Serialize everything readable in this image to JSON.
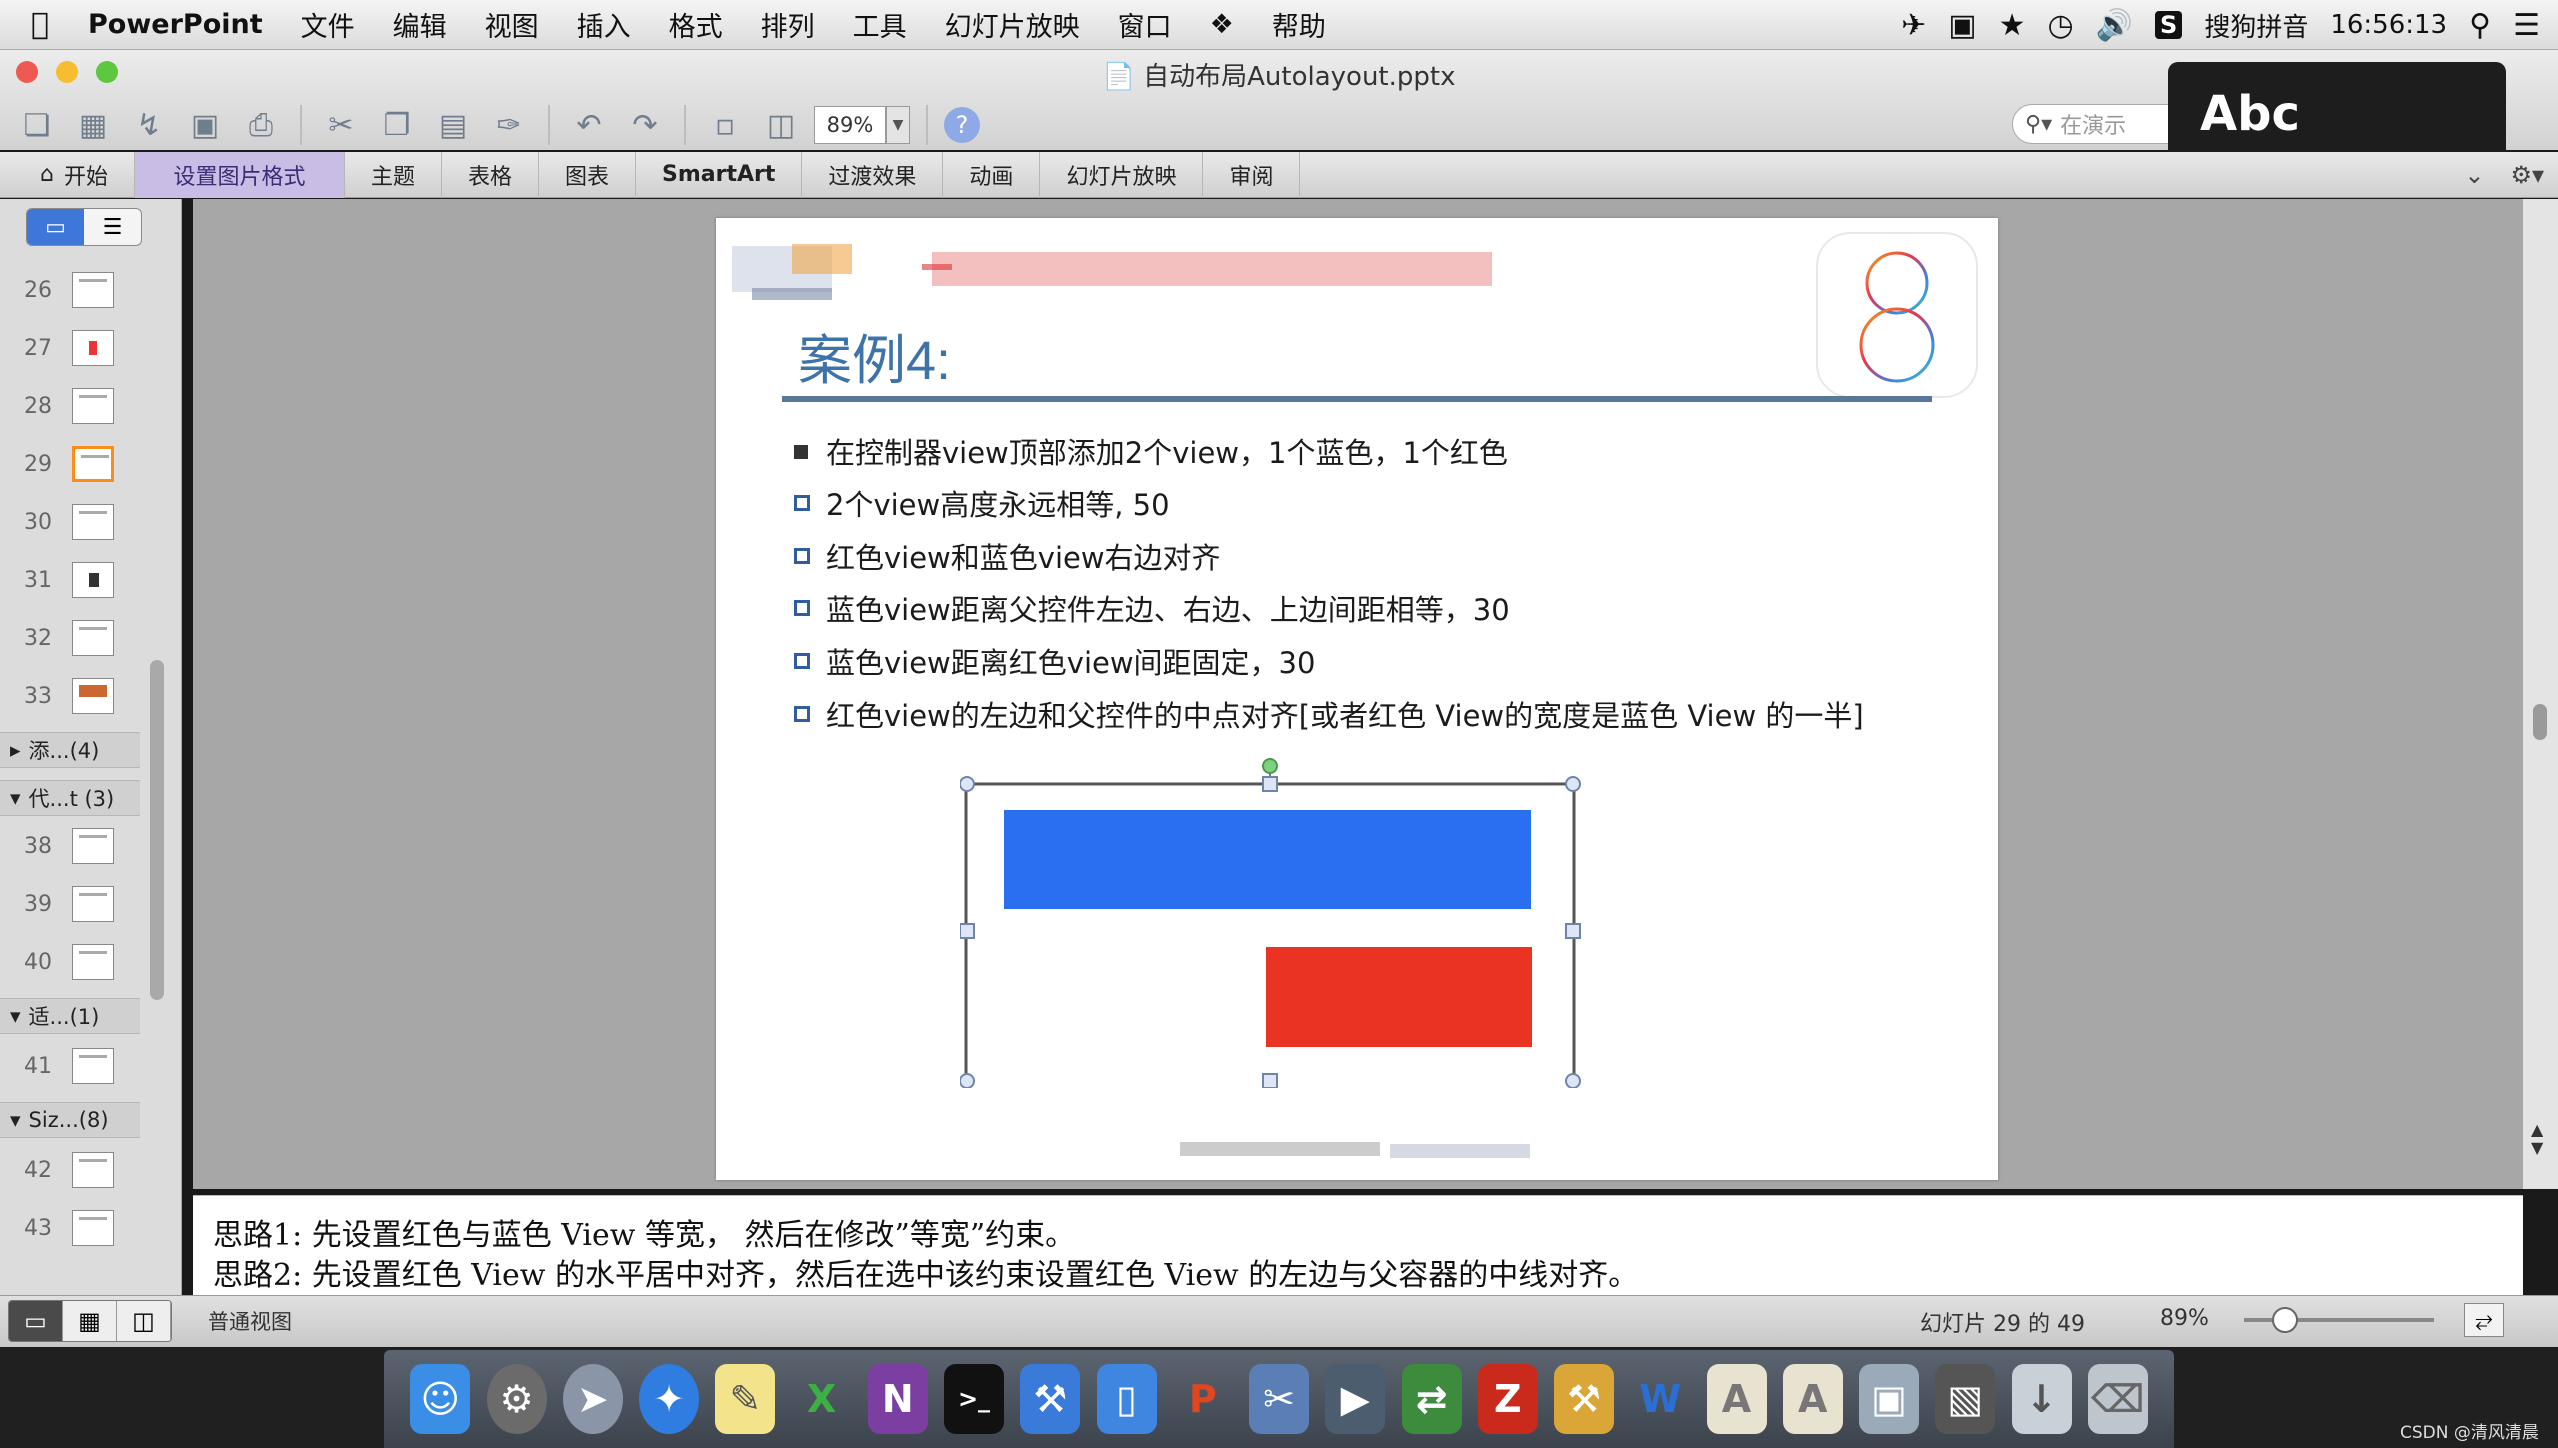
{
  "menubar": {
    "app_name": "PowerPoint",
    "menus": [
      "文件",
      "编辑",
      "视图",
      "插入",
      "格式",
      "排列",
      "工具",
      "幻灯片放映",
      "窗口",
      "帮助"
    ],
    "input_method": "搜狗拼音",
    "time": "16:56:13"
  },
  "window": {
    "title": "自动布局Autolayout.pptx"
  },
  "toolbar": {
    "zoom_value": "89%",
    "search_placeholder": "在演示"
  },
  "overlay": {
    "abc_label": "Abc"
  },
  "ribbon": {
    "tabs": [
      "开始",
      "设置图片格式",
      "主题",
      "表格",
      "图表",
      "SmartArt",
      "过渡效果",
      "动画",
      "幻灯片放映",
      "审阅"
    ],
    "active_tab": "设置图片格式"
  },
  "slide_panel": {
    "slides_a": [
      "26",
      "27",
      "28",
      "29",
      "30",
      "31",
      "32",
      "33"
    ],
    "selected_slide": "29",
    "sections": [
      "添...(4)",
      "代...t (3)",
      "适...(1)",
      "Siz...(8)"
    ],
    "slides_b": [
      "38",
      "39",
      "40"
    ],
    "slides_c": [
      "41"
    ],
    "slides_d": [
      "42",
      "43"
    ]
  },
  "slide": {
    "title": "案例4:",
    "os_badge": "8",
    "bullets": [
      "在控制器view顶部添加2个view，1个蓝色，1个红色",
      "2个view高度永远相等, 50",
      "红色view和蓝色view右边对齐",
      "蓝色view距离父控件左边、右边、上边间距相等，30",
      "蓝色view距离红色view间距固定，30",
      "红色view的左边和父控件的中点对齐[或者红色 View的宽度是蓝色 View 的一半]"
    ],
    "colors": {
      "blue_view": "#2a6ff0",
      "red_view": "#ea3322",
      "title": "#3e73a9"
    }
  },
  "notes": {
    "line1": "思路1:  先设置红色与蓝色 View 等宽， 然后在修改”等宽”约束。",
    "line2": "思路2:  先设置红色 View 的水平居中对齐，然后在选中该约束设置红色 View 的左边与父容器的中线对齐。"
  },
  "statusbar": {
    "view_label": "普通视图",
    "slide_count": "幻灯片 29 的 49",
    "zoom": "89%"
  },
  "watermark": "CSDN @清风清晨"
}
